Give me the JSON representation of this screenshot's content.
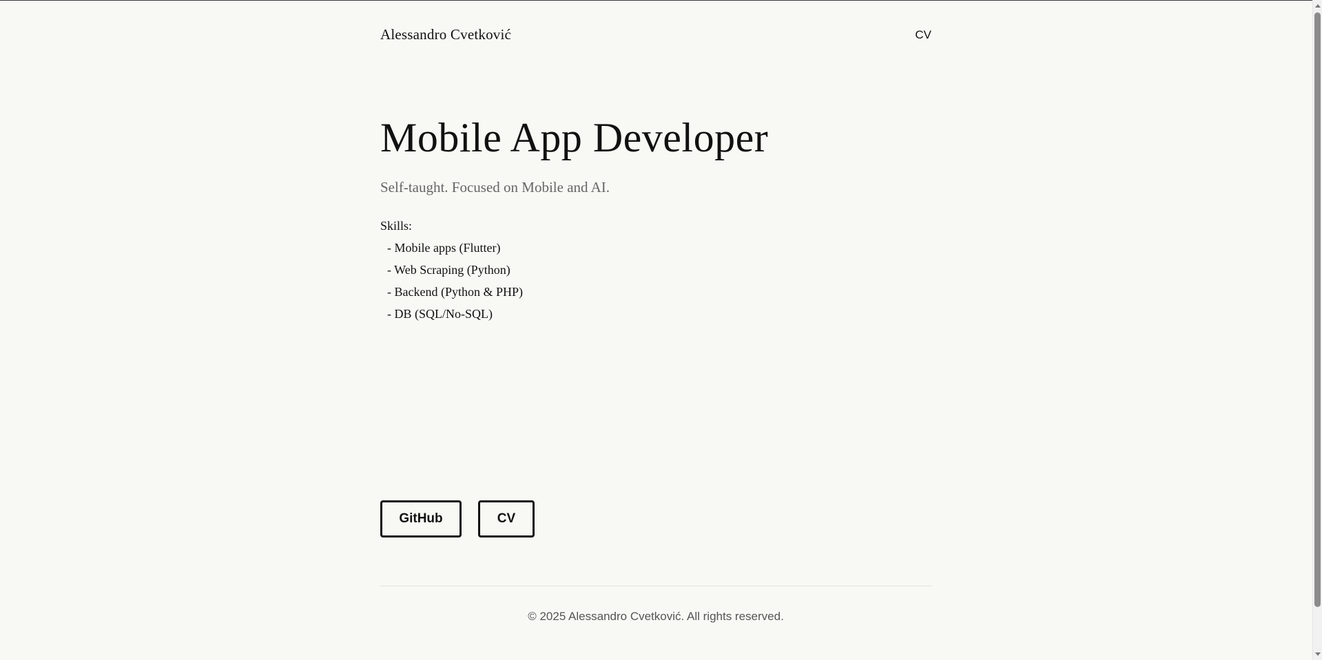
{
  "header": {
    "site_name": "Alessandro Cvetković",
    "nav_cv": "CV"
  },
  "hero": {
    "title": "Mobile App Developer",
    "subtitle": "Self-taught. Focused on Mobile and AI."
  },
  "skills": {
    "heading": "Skills:",
    "items": [
      "- Mobile apps (Flutter)",
      "- Web Scraping (Python)",
      "- Backend (Python & PHP)",
      "- DB (SQL/No-SQL)"
    ]
  },
  "buttons": {
    "github": "GitHub",
    "cv": "CV"
  },
  "footer": {
    "copyright": "© 2025 Alessandro Cvetković. All rights reserved."
  }
}
